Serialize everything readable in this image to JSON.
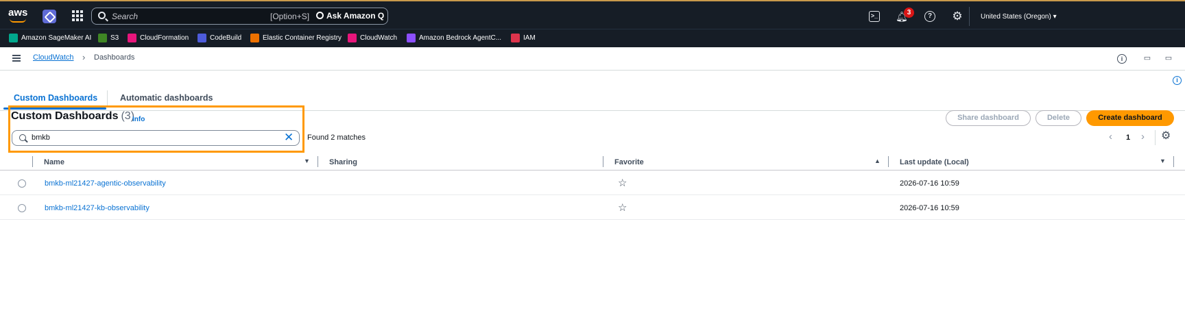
{
  "top_nav": {
    "logo": "aws",
    "search_placeholder": "Search",
    "search_shortcut": "[Option+S]",
    "ask_q": "Ask Amazon Q",
    "notification_count": "3",
    "region": "United States (Oregon) ▾"
  },
  "favorites": [
    {
      "label": "Amazon SageMaker AI",
      "color": "#01a88d"
    },
    {
      "label": "S3",
      "color": "#3f8624"
    },
    {
      "label": "CloudFormation",
      "color": "#e7157b"
    },
    {
      "label": "CodeBuild",
      "color": "#4d27aa"
    },
    {
      "label": "Elastic Container Registry",
      "color": "#ed7100"
    },
    {
      "label": "CloudWatch",
      "color": "#e7157b"
    },
    {
      "label": "Amazon Bedrock AgentC...",
      "color": "#8c4fff"
    },
    {
      "label": "IAM",
      "color": "#dd344c"
    }
  ],
  "breadcrumb": {
    "root": "CloudWatch",
    "separator": "›",
    "current": "Dashboards"
  },
  "tabs": {
    "custom": "Custom Dashboards",
    "automatic": "Automatic dashboards"
  },
  "section": {
    "title": "Custom Dashboards",
    "count": "(3)",
    "info": "Info",
    "filter_value": "bmkb",
    "clear_icon": "✕",
    "matches": "Found 2 matches"
  },
  "actions": {
    "share": "Share dashboard",
    "delete": "Delete",
    "create": "Create dashboard"
  },
  "pagination": {
    "prev": "‹",
    "page": "1",
    "next": "›"
  },
  "table": {
    "columns": {
      "name": "Name",
      "sharing": "Sharing",
      "favorite": "Favorite",
      "last_update": "Last update (Local)"
    },
    "rows": [
      {
        "name": "bmkb-ml21427-agentic-observability",
        "favorite": "☆",
        "last_update": "2026-07-16 10:59"
      },
      {
        "name": "bmkb-ml21427-kb-observability",
        "favorite": "☆",
        "last_update": "2026-07-16 10:59"
      }
    ]
  },
  "colors": {
    "link": "#0972d3",
    "primary": "#ff9900",
    "highlight": "#ff9900",
    "topbar": "#161d26"
  }
}
